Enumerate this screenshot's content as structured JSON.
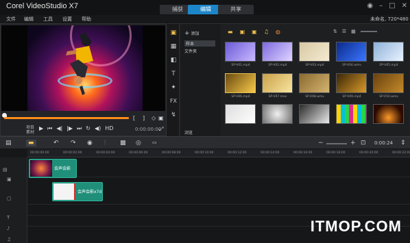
{
  "window": {
    "title": "Corel VideoStudio X7",
    "tabs": [
      {
        "label": "捕获",
        "active": false
      },
      {
        "label": "编辑",
        "active": true
      },
      {
        "label": "共享",
        "active": false
      }
    ],
    "controls": [
      "info-icon",
      "minimize-icon",
      "maximize-icon",
      "close-icon"
    ]
  },
  "menu": {
    "items": [
      "文件",
      "编辑",
      "工具",
      "设置",
      "帮助"
    ],
    "project_info": "未命名, 720*480"
  },
  "preview": {
    "labels": {
      "project": "项目",
      "clip": "素材"
    },
    "quality": "HD",
    "accent": "#ff8c1a"
  },
  "library": {
    "add_label": "添加",
    "folders": [
      {
        "label": "样本",
        "active": true
      },
      {
        "label": "文件夹",
        "active": false
      }
    ],
    "browse_label": "浏览",
    "thumbs": [
      {
        "label": "SP-V01.mp4",
        "selected": false
      },
      {
        "label": "SP-V02.mp4",
        "selected": false
      },
      {
        "label": "SP-V03.mp4",
        "selected": false
      },
      {
        "label": "SP-V04.wmv",
        "selected": false
      },
      {
        "label": "SP-V05.mp4",
        "selected": false
      },
      {
        "label": "SP-V06.mp4",
        "selected": true
      },
      {
        "label": "SP-V07.mov",
        "selected": false
      },
      {
        "label": "SP-V08.wmv",
        "selected": false
      },
      {
        "label": "SP-V09.mp4",
        "selected": false
      },
      {
        "label": "SP-V10.wmv",
        "selected": false
      },
      {
        "label": "",
        "selected": false
      },
      {
        "label": "",
        "selected": false
      },
      {
        "label": "",
        "selected": false
      },
      {
        "label": "",
        "selected": false
      },
      {
        "label": "",
        "selected": false
      }
    ]
  },
  "timeline": {
    "timecode": "0:00:24",
    "ruler_ticks": [
      "00:00:00:00",
      "00:00:02:00",
      "00:00:04:00",
      "00:00:06:00",
      "00:00:08:00",
      "00:00:10:00",
      "00:00:12:00",
      "00:00:14:00",
      "00:00:16:00",
      "00:00:18:00",
      "00:00:20:00",
      "00:00:22:00"
    ],
    "clips": [
      {
        "label": "会声会影",
        "track": "video"
      },
      {
        "label": "会声会影x7d",
        "track": "overlay"
      }
    ]
  },
  "watermark": "ITMOP.COM"
}
